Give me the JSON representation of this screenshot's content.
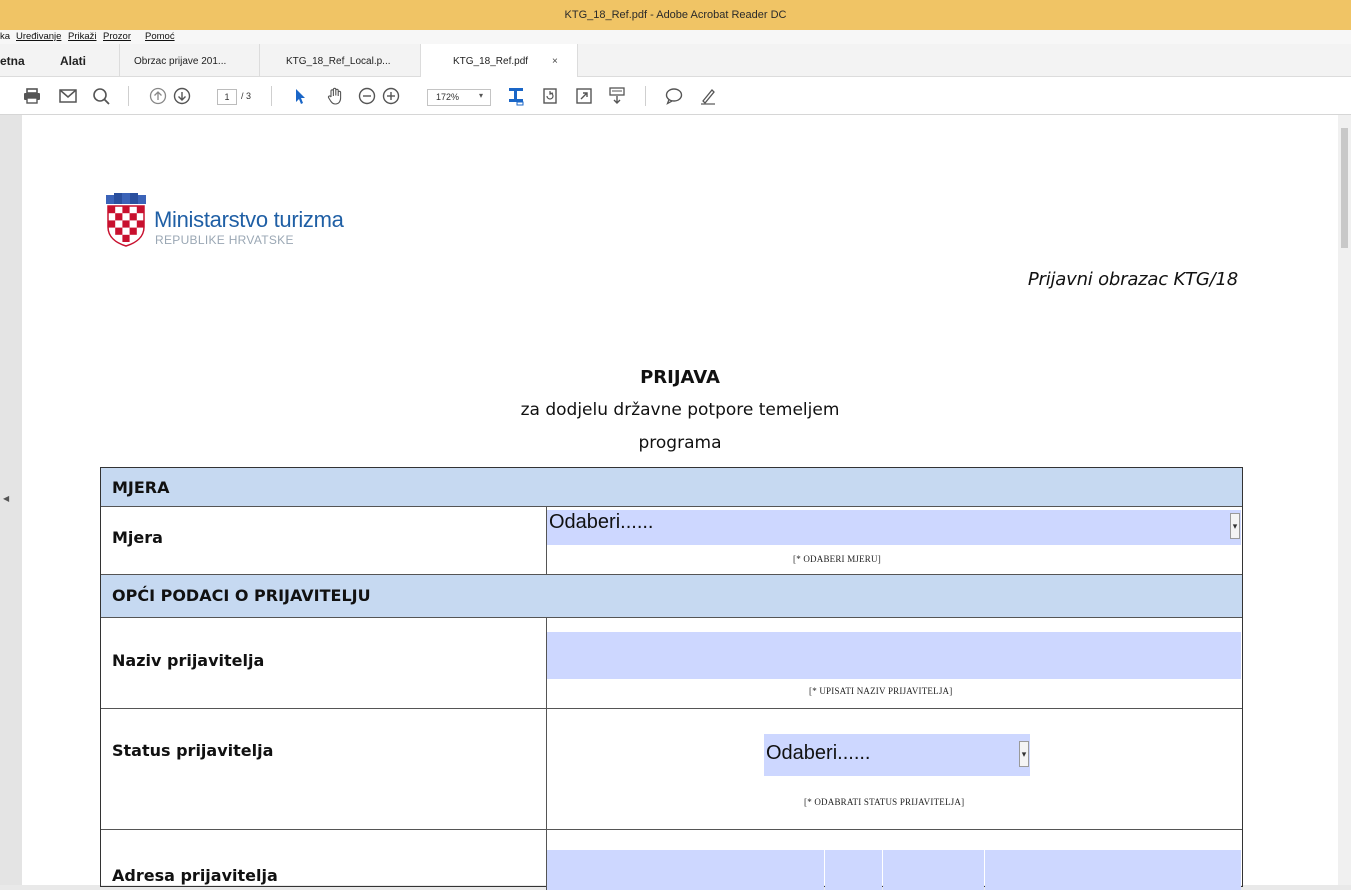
{
  "window": {
    "title": "KTG_18_Ref.pdf - Adobe Acrobat Reader DC"
  },
  "menu": {
    "items": [
      "ka",
      "Uređivanje",
      "Prikaži",
      "Prozor",
      "Pomoć"
    ]
  },
  "tabs": {
    "home": "etna",
    "tools": "Alati",
    "documents": [
      {
        "label": "Obrzac prijave 201..."
      },
      {
        "label": "KTG_18_Ref_Local.p..."
      },
      {
        "label": "KTG_18_Ref.pdf"
      }
    ],
    "close_glyph": "×"
  },
  "toolbar": {
    "page_current": "1",
    "page_total": "/ 3",
    "zoom": "172%",
    "icons": [
      "print-icon",
      "email-icon",
      "search-icon",
      "page-up-icon",
      "page-down-icon",
      "select-cursor-icon",
      "hand-icon",
      "zoom-out-icon",
      "zoom-in-icon",
      "fit-page-icon",
      "rotate-icon",
      "full-screen-icon",
      "scroll-mode-icon",
      "comment-icon",
      "sign-icon"
    ]
  },
  "document": {
    "ministry_name": "Ministarstvo turizma",
    "ministry_sub": "REPUBLIKE HRVATSKE",
    "form_id": "Prijavni obrazac KTG/18",
    "heading_line1": "PRIJAVA",
    "heading_line2": "za dodjelu državne potpore temeljem",
    "heading_line3": "programa",
    "form": {
      "section_measure": "MJERA",
      "measure_label": "Mjera",
      "measure_value": "Odaberi......",
      "measure_hint": "[* ODABERI MJERU]",
      "section_general": "OPĆI PODACI O PRIJAVITELJU",
      "applicant_name_label": "Naziv prijavitelja",
      "applicant_name_hint": "[* UPISATI NAZIV PRIJAVITELJA]",
      "applicant_status_label": "Status prijavitelja",
      "applicant_status_value": "Odaberi......",
      "applicant_status_hint": "[* ODABRATI STATUS PRIJAVITELJA]",
      "applicant_address_label": "Adresa prijavitelja"
    }
  },
  "colors": {
    "titlebar": "#f0c465",
    "section_fill": "#c6d9f1",
    "field_fill": "#cdd7ff",
    "ministry_blue": "#1f5fa5"
  }
}
